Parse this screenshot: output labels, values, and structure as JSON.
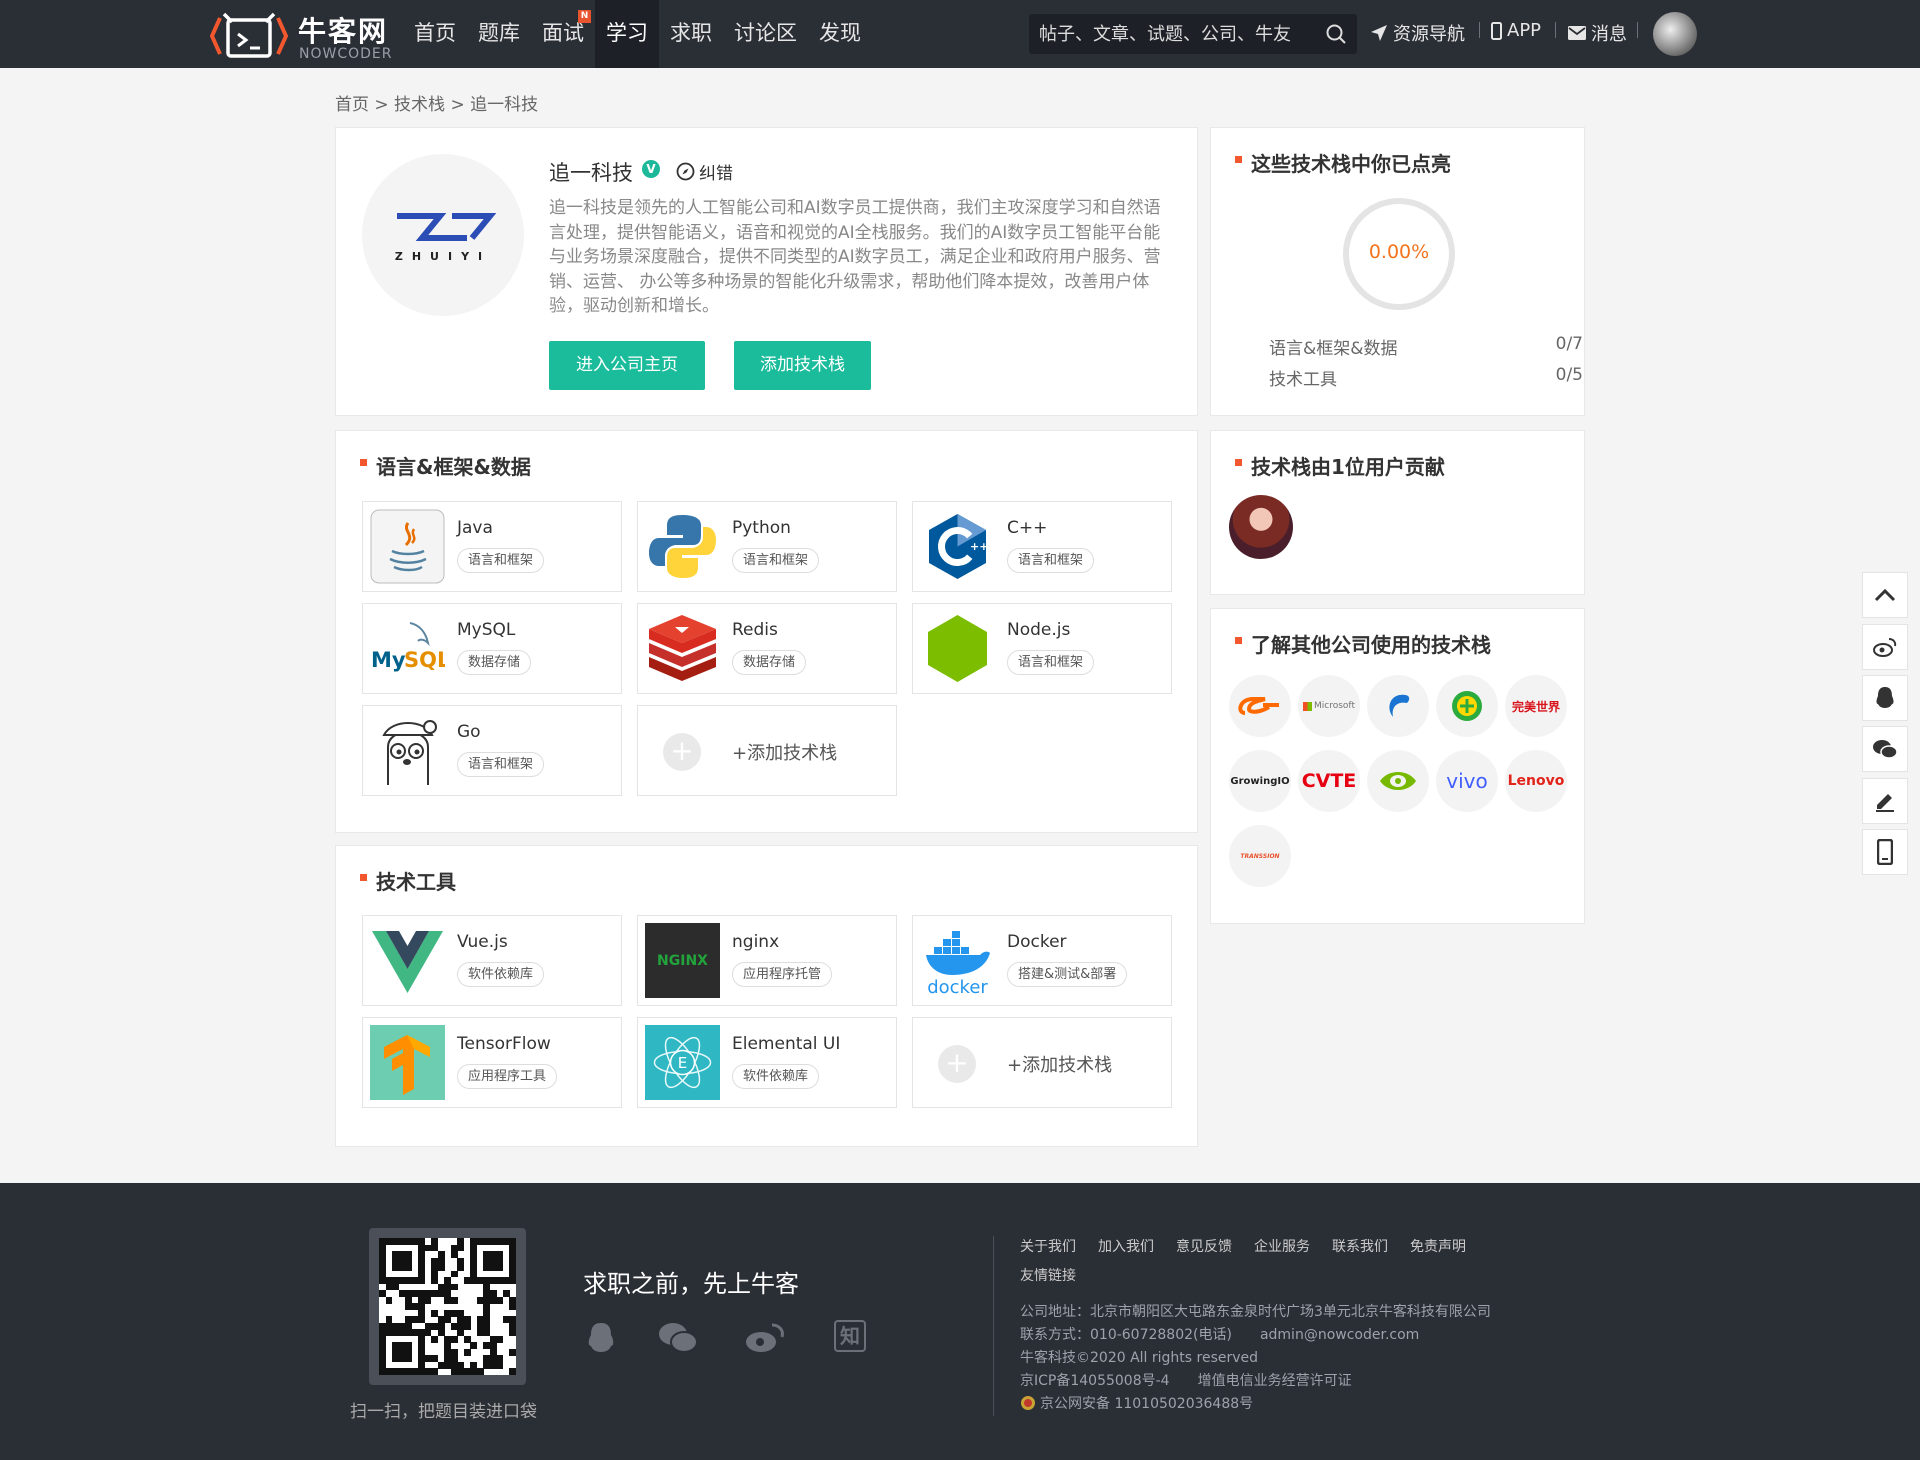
{
  "header": {
    "logo_cn": "牛客网",
    "logo_en": "NOWCODER",
    "nav": [
      {
        "label": "首页",
        "active": false
      },
      {
        "label": "题库",
        "active": false
      },
      {
        "label": "面试",
        "active": false,
        "badge": "N"
      },
      {
        "label": "学习",
        "active": true
      },
      {
        "label": "求职",
        "active": false
      },
      {
        "label": "讨论区",
        "active": false
      },
      {
        "label": "发现",
        "active": false
      }
    ],
    "search_placeholder": "帖子、文章、试题、公司、牛友",
    "resource_nav": "资源导航",
    "app": "APP",
    "messages": "消息"
  },
  "breadcrumb": "首页 > 技术栈 > 追一科技",
  "company": {
    "logo_text": "ZHUIYI",
    "name": "追一科技",
    "verified_mark": "V",
    "correct_label": "纠错",
    "description": "追一科技是领先的人工智能公司和AI数字员工提供商，我们主攻深度学习和自然语言处理，提供智能语义，语音和视觉的AI全栈服务。我们的AI数字员工智能平台能与业务场景深度融合，提供不同类型的AI数字员工，满足企业和政府用户服务、营销、运营、 办公等多种场景的智能化升级需求，帮助他们降本提效，改善用户体验，驱动创新和增长。",
    "btn_home": "进入公司主页",
    "btn_add": "添加技术栈"
  },
  "progress": {
    "title": "这些技术栈中你已点亮",
    "percent_text": "0.00%",
    "percent_value": 0,
    "rows": [
      {
        "label": "语言&框架&数据",
        "value": "0/7"
      },
      {
        "label": "技术工具",
        "value": "0/5"
      }
    ]
  },
  "lang_section": {
    "title": "语言&框架&数据",
    "items": [
      {
        "name": "Java",
        "tag": "语言和框架",
        "icon": "java-icon"
      },
      {
        "name": "Python",
        "tag": "语言和框架",
        "icon": "python-icon"
      },
      {
        "name": "C++",
        "tag": "语言和框架",
        "icon": "cpp-icon"
      },
      {
        "name": "MySQL",
        "tag": "数据存储",
        "icon": "mysql-icon"
      },
      {
        "name": "Redis",
        "tag": "数据存储",
        "icon": "redis-icon"
      },
      {
        "name": "Node.js",
        "tag": "语言和框架",
        "icon": "nodejs-icon"
      },
      {
        "name": "Go",
        "tag": "语言和框架",
        "icon": "go-icon"
      }
    ],
    "add_label": "+添加技术栈",
    "add_icon_glyph": "+"
  },
  "tools_section": {
    "title": "技术工具",
    "items": [
      {
        "name": "Vue.js",
        "tag": "软件依赖库",
        "icon": "vue-icon"
      },
      {
        "name": "nginx",
        "tag": "应用程序托管",
        "icon": "nginx-icon"
      },
      {
        "name": "Docker",
        "tag": "搭建&测试&部署",
        "icon": "docker-icon"
      },
      {
        "name": "TensorFlow",
        "tag": "应用程序工具",
        "icon": "tensorflow-icon"
      },
      {
        "name": "Elemental UI",
        "tag": "软件依赖库",
        "icon": "elemental-icon"
      }
    ],
    "add_label": "+添加技术栈",
    "add_icon_glyph": "+"
  },
  "contributors": {
    "title": "技术栈由1位用户贡献"
  },
  "other_companies": {
    "title": "了解其他公司使用的技术栈",
    "logos": [
      {
        "name": "alibaba-logo",
        "text": "",
        "color": "#ff6a00"
      },
      {
        "name": "microsoft-logo",
        "text": "Microsoft",
        "color": "#737373"
      },
      {
        "name": "ctrip-logo",
        "text": "",
        "color": "#1a75d2"
      },
      {
        "name": "360-logo",
        "text": "",
        "color": "#2bab3d"
      },
      {
        "name": "perfect-world-logo",
        "text": "完美世界",
        "color": "#d8141d"
      },
      {
        "name": "growingio-logo",
        "text": "GrowingIO",
        "color": "#222222"
      },
      {
        "name": "cvte-logo",
        "text": "CVTE",
        "color": "#e60012"
      },
      {
        "name": "nvidia-logo",
        "text": "",
        "color": "#76b900"
      },
      {
        "name": "vivo-logo",
        "text": "vivo",
        "color": "#415fff"
      },
      {
        "name": "lenovo-logo",
        "text": "Lenovo",
        "color": "#e2231a"
      },
      {
        "name": "transsion-logo",
        "text": "TRANSSION",
        "color": "#e8542e"
      }
    ]
  },
  "footer": {
    "qr_caption": "扫一扫，把题目装进口袋",
    "slogan": "求职之前，先上牛客",
    "links": [
      "关于我们",
      "加入我们",
      "意见反馈",
      "企业服务",
      "联系我们",
      "免责声明"
    ],
    "friend_links": "友情链接",
    "address": "公司地址：北京市朝阳区大屯路东金泉时代广场3单元北京牛客科技有限公司",
    "contact": "联系方式：010-60728802(电话)　　admin@nowcoder.com",
    "copyright": "牛客科技©2020 All rights reserved",
    "icp": "京ICP备14055008号-4　　增值电信业务经营许可证",
    "police": "京公网安备 11010502036488号",
    "zhihu_glyph": "知"
  },
  "colors": {
    "accent_green": "#1bbc9b",
    "accent_orange": "#f2572e",
    "header_bg": "#2a2e35"
  }
}
